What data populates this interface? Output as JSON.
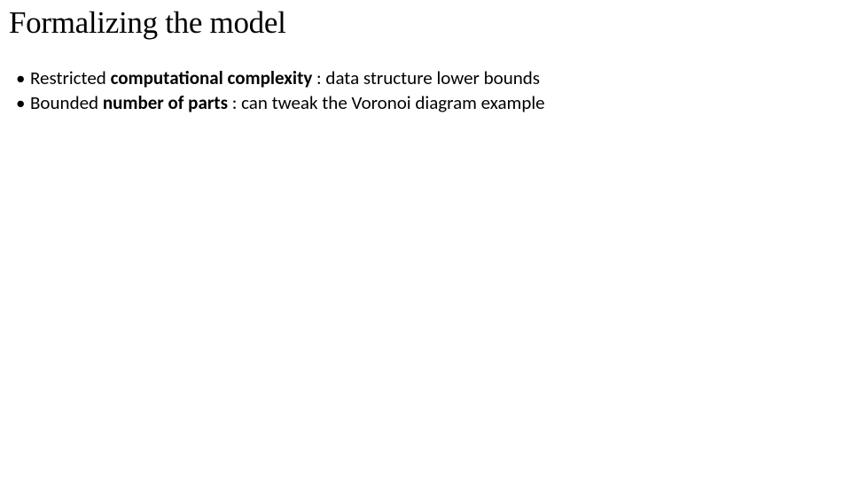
{
  "title": "Formalizing the model",
  "bullets": [
    {
      "bold": "computational complexity",
      "prefix": "Restricted ",
      "suffix": " : data structure lower bounds"
    },
    {
      "bold": "number of parts",
      "prefix": "Bounded ",
      "suffix": " : can tweak the Voronoi diagram example"
    }
  ]
}
